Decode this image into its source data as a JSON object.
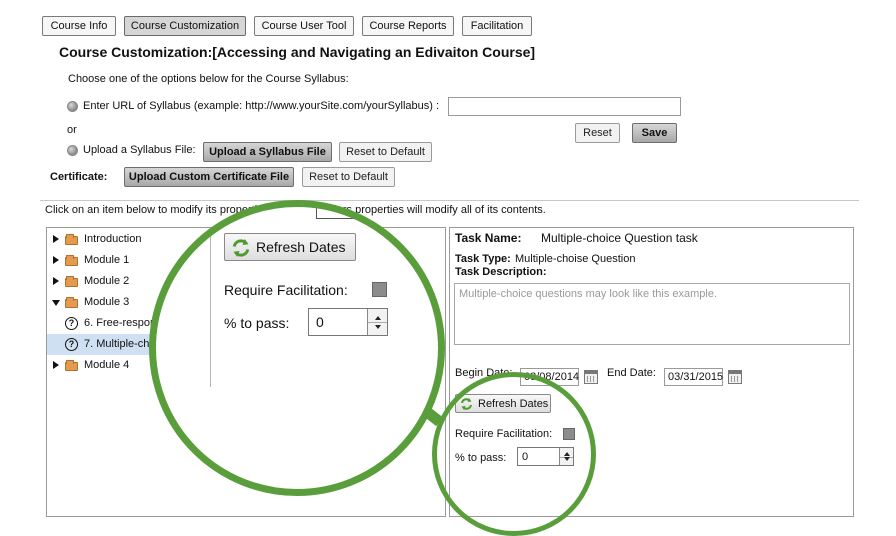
{
  "tabs": [
    {
      "label": "Course Info",
      "active": false
    },
    {
      "label": "Course Customization",
      "active": true
    },
    {
      "label": "Course User Tool",
      "active": false
    },
    {
      "label": "Course Reports",
      "active": false
    },
    {
      "label": "Facilitation",
      "active": false
    }
  ],
  "page_title": "Course Customization:[Accessing and Navigating an Edivaiton Course]",
  "syllabus": {
    "prompt": "Choose one of the options below for the Course Syllabus:",
    "url_option_label": "Enter URL of Syllabus (example: http://www.yourSite.com/yourSyllabus) :",
    "url_value": "",
    "or_label": "or",
    "file_option_label": "Upload a Syllabus File:",
    "upload_button": "Upload a Syllabus File",
    "reset_default_button": "Reset to Default",
    "reset_button": "Reset",
    "save_button": "Save"
  },
  "certificate": {
    "label": "Certificate:",
    "upload_button": "Upload Custom Certificate File",
    "reset_default_button": "Reset to Default"
  },
  "instruction_parts": [
    "Click on an item below to modify its properties",
    "folders properties will modify all of its contents."
  ],
  "tree": [
    {
      "label": "Introduction",
      "type": "folder",
      "expanded": false
    },
    {
      "label": "Module 1",
      "type": "folder",
      "expanded": false
    },
    {
      "label": "Module 2",
      "type": "folder",
      "expanded": false
    },
    {
      "label": "Module 3",
      "type": "folder",
      "expanded": true
    },
    {
      "label": "6.  Free-respons",
      "type": "question"
    },
    {
      "label": "7.  Multiple-choi",
      "type": "question",
      "selected": true
    },
    {
      "label": "Module 4",
      "type": "folder",
      "expanded": false
    }
  ],
  "details": {
    "task_name_label": "Task Name:",
    "task_name_value": "Multiple-choice Question task",
    "task_type_label": "Task Type:",
    "task_type_value": "Multiple-choise Question",
    "task_description_label": "Task Description:",
    "task_description_value": "Multiple-choice questions may look like this example.",
    "begin_date_label": "Begin Date:",
    "begin_date_value": "03/08/2014",
    "end_date_label": "End Date:",
    "end_date_value": "03/31/2015",
    "refresh_button": "Refresh Dates",
    "require_facilitation_label": "Require Facilitation:",
    "percent_to_pass_label": "% to pass:",
    "percent_to_pass_value": "0"
  },
  "magnifier": {
    "refresh_button": "Refresh Dates",
    "require_facilitation_label": "Require Facilitation:",
    "percent_to_pass_label": "% to pass:",
    "percent_to_pass_value": "0"
  },
  "colors": {
    "magnifier_ring": "#5a9e3c",
    "selected_row": "#cfe0f2",
    "folder": "#e49b4f"
  }
}
